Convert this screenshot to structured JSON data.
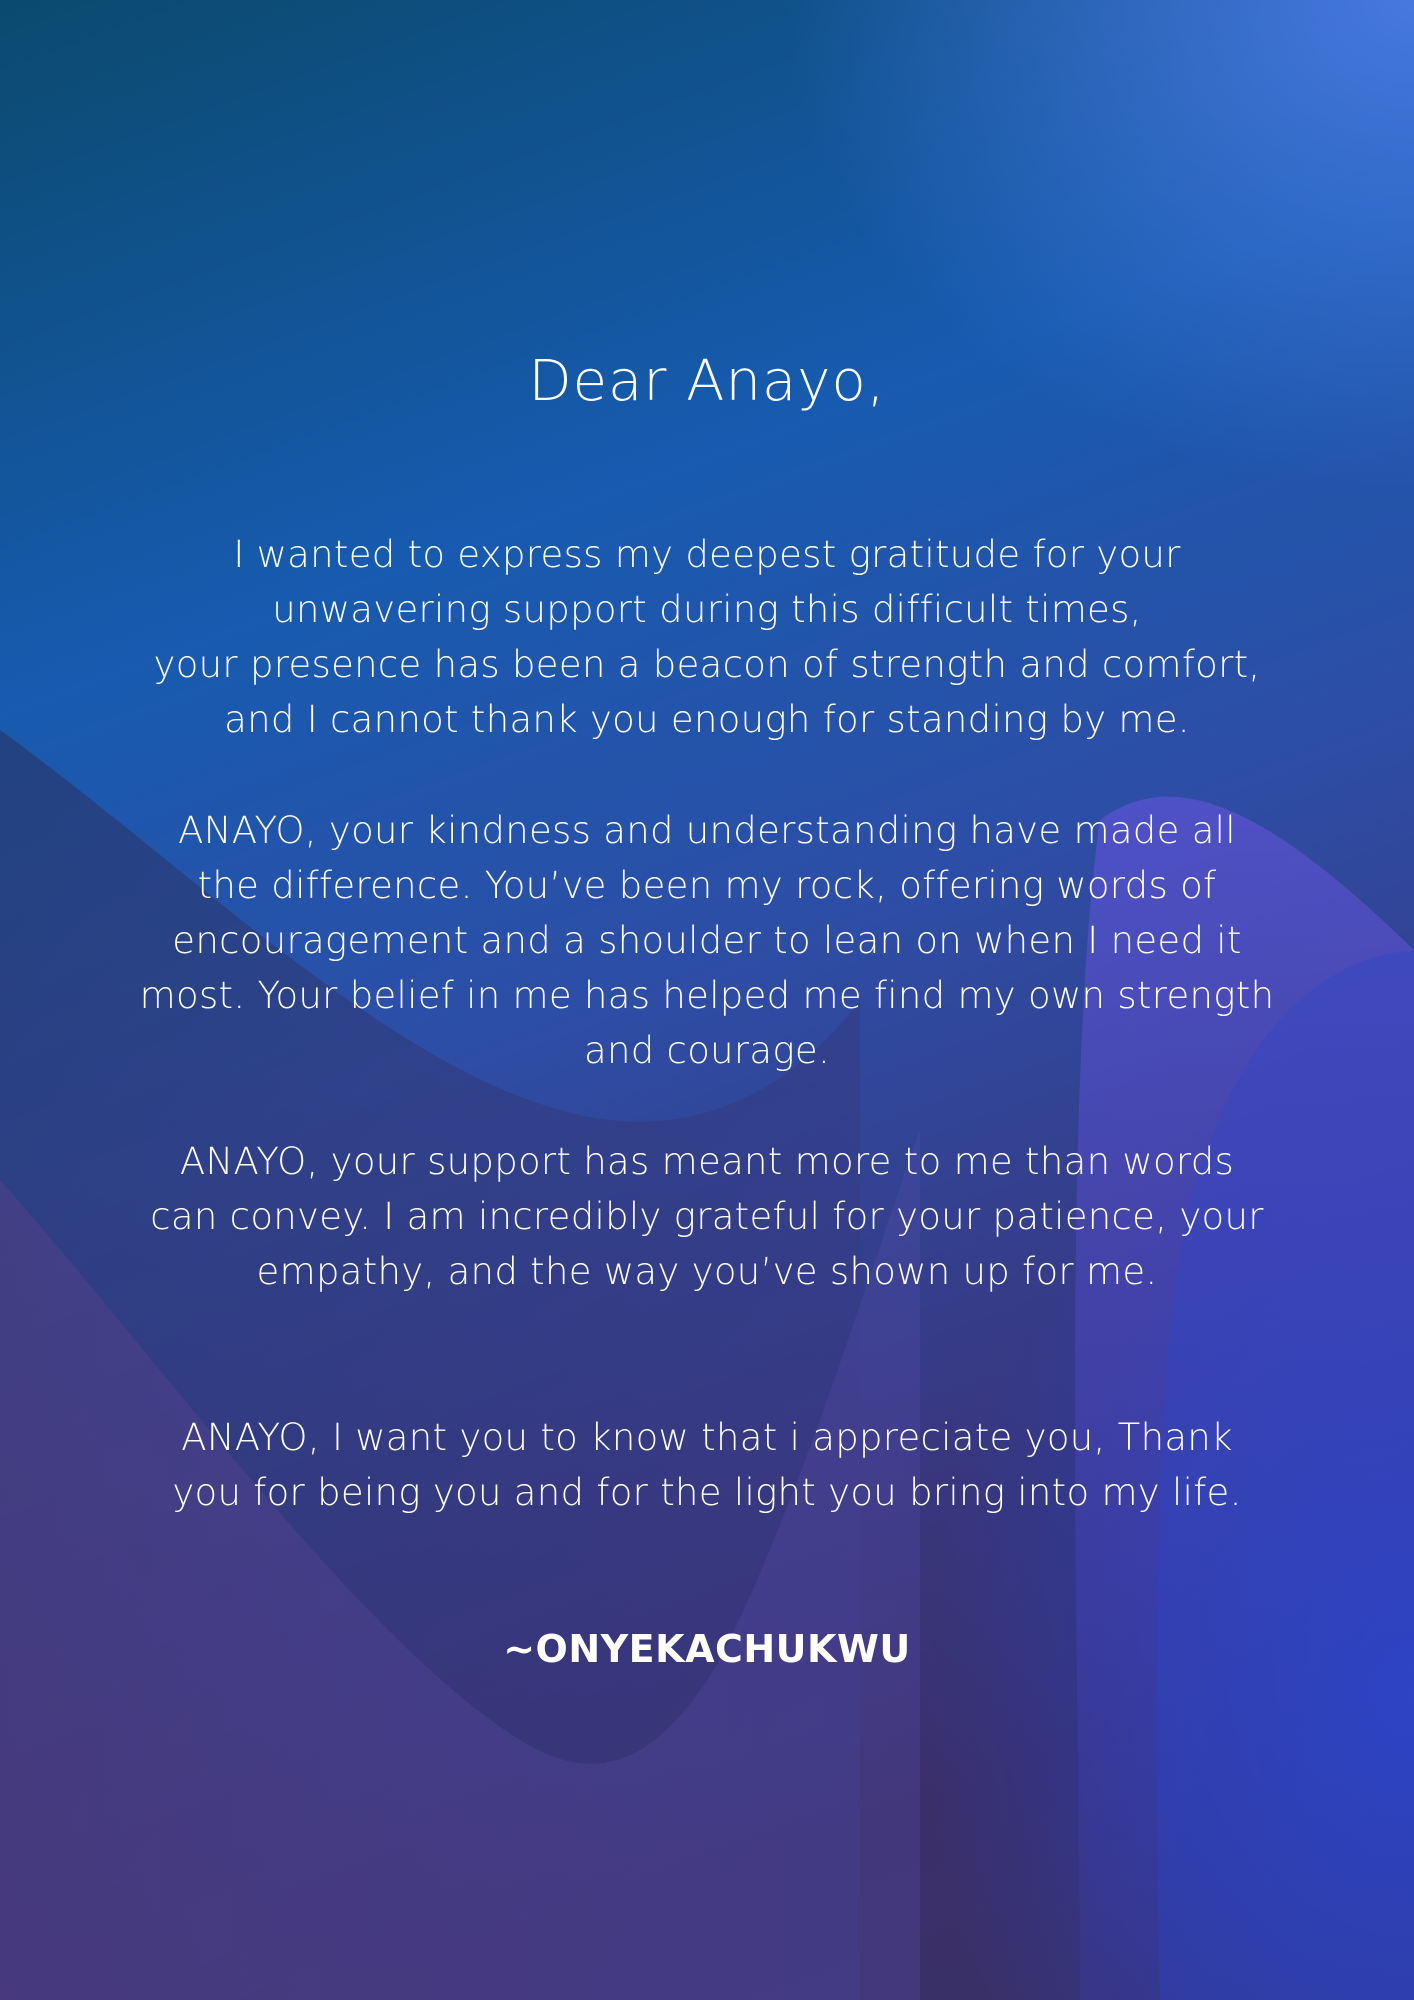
{
  "letter": {
    "greeting": "Dear Anayo,",
    "paragraphs": [
      {
        "lines": [
          "I wanted to express my deepest gratitude for your",
          "unwavering support during this difficult times,",
          "your presence has been a beacon of strength and comfort,",
          "and I cannot thank you enough for standing by me."
        ]
      },
      {
        "lines": [
          "ANAYO, your kindness and understanding have made all",
          "the difference. You’ve been my rock, offering words of",
          "encouragement and a shoulder to lean on when I need it",
          "most. Your belief in me has helped me find my own strength",
          "and courage."
        ]
      },
      {
        "lines": [
          "ANAYO, your support has meant more to me than words",
          "can convey. I am incredibly grateful for your patience, your",
          "empathy, and the way you’ve shown up for me."
        ]
      },
      {
        "lines": [
          "ANAYO, I want you to know that i appreciate you, Thank",
          "you for being you and for the light you bring into my life."
        ]
      }
    ],
    "signature": "~ONYEKACHUKWU"
  },
  "colors": {
    "text": "#ffffff",
    "background_top": "#0b4a6e",
    "background_mid": "#2d4ea6",
    "background_bottom": "#3a3166",
    "accent_purple": "#5b4fd6",
    "accent_blue": "#2142c8"
  }
}
